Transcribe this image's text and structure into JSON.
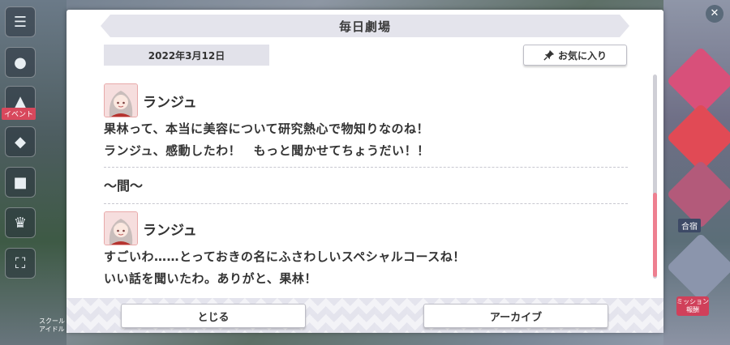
{
  "dialog": {
    "title": "毎日劇場",
    "date": "2022年3月12日",
    "favorite_label": "お気に入り",
    "close_label": "とじる",
    "archive_label": "アーカイブ"
  },
  "entries": [
    {
      "speaker": "ランジュ",
      "lines": [
        "果林って、本当に美容について研究熱心で物知りなのね！",
        "ランジュ、感動したわ！　もっと聞かせてちょうだい！！"
      ]
    },
    {
      "speaker": "ランジュ",
      "lines": [
        "すごいわ……とっておきの名にふさわしいスペシャルコースね！",
        "いい話を聞いたわ。ありがと、果林！"
      ]
    }
  ],
  "interlude": "～間～",
  "background": {
    "left_event_tag": "イベント",
    "left_bottom_tag": "スクール アイドル",
    "right_label": "合宿",
    "right_badge": "ミッション 報酬"
  },
  "scroll": {
    "position_fraction": 1.0
  },
  "colors": {
    "accent": "#ee7f90",
    "banner": "#e4e4ec"
  }
}
